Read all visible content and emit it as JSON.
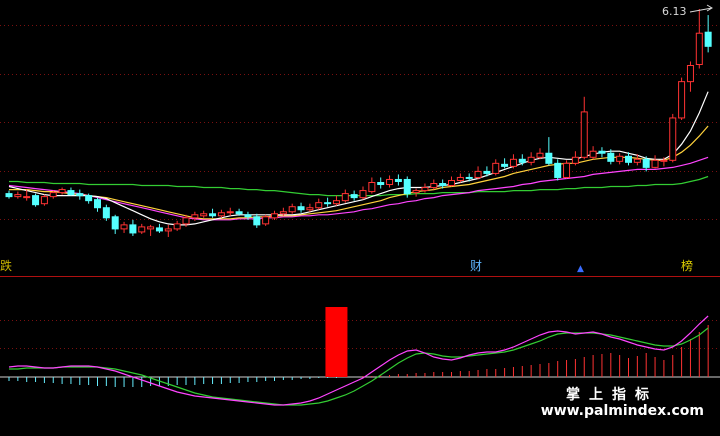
{
  "markers": {
    "left": "跌",
    "cai": "财",
    "triangle": "▲",
    "bang": "榜"
  },
  "price_max": "6.13",
  "watermark": {
    "line1": "掌上指标",
    "line2": "www.palmindex.com"
  },
  "colors": {
    "up": "#ff3333",
    "down": "#55ffff",
    "ma_white": "#ffffff",
    "ma_yellow": "#ffd23c",
    "ma_magenta": "#ff44ff",
    "ma_green": "#33cc33",
    "grid": "#7a1010",
    "macd_pos": "#ff3333",
    "macd_neg": "#66eeff",
    "signal": "#ff0000"
  },
  "chart_data": [
    {
      "type": "candlestick",
      "title": "",
      "y_annotation": "6.13",
      "candles": [
        [
          13.6,
          13.3,
          13.9,
          13.1
        ],
        [
          13.3,
          13.5,
          13.8,
          13.1
        ],
        [
          13.2,
          13.3,
          14.0,
          12.9
        ],
        [
          13.4,
          12.5,
          13.6,
          12.3
        ],
        [
          12.6,
          13.3,
          13.5,
          12.4
        ],
        [
          13.3,
          13.7,
          13.9,
          13.1
        ],
        [
          13.7,
          14.0,
          14.2,
          13.5
        ],
        [
          13.9,
          13.5,
          14.2,
          13.4
        ],
        [
          13.6,
          13.4,
          14.0,
          13.0
        ],
        [
          13.4,
          12.9,
          13.6,
          12.6
        ],
        [
          13.0,
          12.2,
          13.2,
          11.8
        ],
        [
          12.2,
          11.2,
          12.5,
          10.9
        ],
        [
          11.3,
          10.1,
          11.5,
          9.6
        ],
        [
          10.1,
          10.5,
          10.8,
          9.7
        ],
        [
          10.5,
          9.7,
          11.0,
          9.4
        ],
        [
          9.8,
          10.3,
          10.6,
          9.6
        ],
        [
          10.1,
          10.3,
          10.5,
          9.4
        ],
        [
          10.2,
          9.9,
          10.6,
          9.7
        ],
        [
          9.9,
          10.1,
          10.5,
          9.3
        ],
        [
          10.1,
          10.6,
          10.9,
          9.9
        ],
        [
          10.6,
          11.2,
          11.5,
          10.3
        ],
        [
          11.2,
          11.5,
          11.8,
          10.9
        ],
        [
          11.4,
          11.6,
          11.9,
          11.2
        ],
        [
          11.6,
          11.4,
          12.1,
          11.2
        ],
        [
          11.4,
          11.7,
          12.0,
          11.2
        ],
        [
          11.7,
          11.8,
          12.2,
          11.4
        ],
        [
          11.8,
          11.6,
          12.1,
          11.4
        ],
        [
          11.5,
          11.3,
          11.8,
          11.0
        ],
        [
          11.3,
          10.5,
          11.6,
          10.2
        ],
        [
          10.6,
          11.3,
          11.5,
          10.4
        ],
        [
          11.2,
          11.6,
          11.9,
          11.0
        ],
        [
          11.6,
          11.8,
          12.2,
          11.4
        ],
        [
          11.8,
          12.3,
          12.6,
          11.6
        ],
        [
          12.3,
          12.0,
          12.7,
          11.7
        ],
        [
          12.0,
          12.2,
          12.6,
          11.8
        ],
        [
          12.2,
          12.7,
          13.1,
          12.0
        ],
        [
          12.7,
          12.6,
          13.2,
          12.3
        ],
        [
          12.6,
          12.9,
          13.4,
          12.4
        ],
        [
          12.9,
          13.6,
          14.0,
          12.7
        ],
        [
          13.5,
          13.2,
          13.9,
          12.9
        ],
        [
          13.2,
          13.9,
          14.3,
          13.0
        ],
        [
          13.8,
          14.7,
          15.2,
          13.6
        ],
        [
          14.7,
          14.5,
          15.2,
          14.1
        ],
        [
          14.5,
          15.0,
          15.4,
          14.2
        ],
        [
          15.0,
          14.8,
          15.5,
          14.4
        ],
        [
          15.0,
          13.6,
          15.3,
          13.2
        ],
        [
          13.7,
          13.9,
          14.1,
          13.3
        ],
        [
          13.9,
          14.2,
          14.6,
          13.7
        ],
        [
          14.2,
          14.6,
          15.0,
          14.0
        ],
        [
          14.6,
          14.4,
          15.0,
          14.1
        ],
        [
          14.4,
          14.9,
          15.3,
          14.3
        ],
        [
          14.9,
          15.2,
          15.6,
          14.7
        ],
        [
          15.2,
          15.1,
          15.6,
          14.8
        ],
        [
          15.2,
          15.8,
          16.3,
          15.0
        ],
        [
          15.8,
          15.6,
          16.3,
          15.3
        ],
        [
          15.6,
          16.6,
          17.0,
          15.4
        ],
        [
          16.5,
          16.3,
          17.1,
          16.1
        ],
        [
          16.3,
          17.0,
          17.5,
          16.1
        ],
        [
          17.0,
          16.7,
          17.5,
          16.4
        ],
        [
          16.7,
          17.2,
          17.7,
          16.4
        ],
        [
          17.2,
          17.6,
          18.1,
          17.0
        ],
        [
          17.6,
          16.6,
          19.2,
          16.4
        ],
        [
          16.6,
          15.2,
          17.0,
          14.9
        ],
        [
          15.2,
          16.6,
          16.9,
          15.1
        ],
        [
          16.6,
          17.2,
          17.8,
          16.4
        ],
        [
          17.2,
          21.7,
          23.2,
          17.0
        ],
        [
          17.2,
          17.8,
          18.3,
          17.0
        ],
        [
          17.8,
          17.6,
          18.2,
          17.2
        ],
        [
          17.6,
          16.8,
          18.0,
          16.5
        ],
        [
          16.8,
          17.3,
          17.6,
          16.5
        ],
        [
          17.3,
          16.7,
          17.7,
          16.4
        ],
        [
          16.7,
          17.0,
          17.5,
          16.4
        ],
        [
          17.0,
          16.2,
          17.3,
          15.8
        ],
        [
          16.2,
          16.9,
          17.4,
          16.1
        ],
        [
          16.8,
          16.9,
          17.2,
          16.3
        ],
        [
          16.9,
          21.1,
          21.5,
          16.7
        ],
        [
          21.1,
          24.7,
          25.1,
          20.9
        ],
        [
          24.7,
          26.3,
          26.7,
          23.7
        ],
        [
          26.4,
          29.5,
          31.9,
          26.0
        ],
        [
          29.6,
          28.2,
          31.3,
          27.6
        ]
      ],
      "ma_white": [
        14.3,
        14.1,
        13.9,
        13.7,
        13.5,
        13.4,
        13.4,
        13.4,
        13.4,
        13.4,
        13.3,
        13.1,
        12.7,
        12.3,
        11.9,
        11.5,
        11.1,
        10.8,
        10.6,
        10.5,
        10.5,
        10.6,
        10.8,
        11.0,
        11.2,
        11.4,
        11.5,
        11.5,
        11.5,
        11.5,
        11.5,
        11.5,
        11.5,
        11.6,
        11.8,
        12.0,
        12.2,
        12.4,
        12.6,
        12.8,
        13.0,
        13.3,
        13.6,
        13.9,
        14.1,
        14.2,
        14.2,
        14.2,
        14.3,
        14.4,
        14.5,
        14.7,
        14.9,
        15.1,
        15.4,
        15.7,
        16.0,
        16.3,
        16.6,
        16.9,
        17.1,
        17.2,
        17.1,
        17.0,
        17.0,
        17.3,
        17.5,
        17.7,
        17.8,
        17.8,
        17.6,
        17.4,
        17.1,
        17.0,
        17.0,
        17.5,
        18.5,
        19.8,
        21.6,
        23.7
      ],
      "ma_yellow": [
        14.0,
        14.0,
        14.0,
        13.9,
        13.8,
        13.8,
        13.7,
        13.6,
        13.5,
        13.4,
        13.3,
        13.2,
        13.0,
        12.8,
        12.6,
        12.4,
        12.2,
        12.0,
        11.8,
        11.6,
        11.4,
        11.2,
        11.1,
        11.1,
        11.1,
        11.1,
        11.2,
        11.2,
        11.3,
        11.3,
        11.4,
        11.4,
        11.4,
        11.5,
        11.6,
        11.7,
        11.8,
        11.9,
        12.1,
        12.3,
        12.5,
        12.7,
        12.9,
        13.2,
        13.4,
        13.6,
        13.8,
        13.9,
        14.0,
        14.2,
        14.3,
        14.4,
        14.5,
        14.7,
        14.9,
        15.1,
        15.3,
        15.6,
        15.8,
        16.0,
        16.2,
        16.4,
        16.5,
        16.6,
        16.6,
        16.8,
        17.0,
        17.1,
        17.2,
        17.2,
        17.2,
        17.1,
        17.0,
        16.9,
        16.9,
        17.2,
        17.7,
        18.4,
        19.3,
        20.3
      ],
      "ma_magenta": [
        14.4,
        14.3,
        14.2,
        14.1,
        14.0,
        13.9,
        13.8,
        13.7,
        13.6,
        13.4,
        13.2,
        13.0,
        12.8,
        12.6,
        12.4,
        12.2,
        12.0,
        11.8,
        11.6,
        11.4,
        11.2,
        11.1,
        11.0,
        11.0,
        11.0,
        11.0,
        11.1,
        11.1,
        11.1,
        11.2,
        11.2,
        11.3,
        11.3,
        11.4,
        11.4,
        11.5,
        11.5,
        11.6,
        11.7,
        11.8,
        12.0,
        12.1,
        12.3,
        12.5,
        12.6,
        12.8,
        12.9,
        13.1,
        13.2,
        13.4,
        13.5,
        13.6,
        13.7,
        13.9,
        14.0,
        14.1,
        14.2,
        14.3,
        14.5,
        14.6,
        14.8,
        14.9,
        15.0,
        15.1,
        15.2,
        15.3,
        15.5,
        15.6,
        15.7,
        15.8,
        15.9,
        16.0,
        16.0,
        16.0,
        16.1,
        16.2,
        16.4,
        16.6,
        16.9,
        17.2
      ],
      "ma_green": [
        14.8,
        14.8,
        14.7,
        14.7,
        14.7,
        14.6,
        14.6,
        14.6,
        14.6,
        14.5,
        14.5,
        14.5,
        14.5,
        14.5,
        14.5,
        14.4,
        14.4,
        14.4,
        14.4,
        14.3,
        14.3,
        14.3,
        14.2,
        14.2,
        14.2,
        14.1,
        14.1,
        14.0,
        14.0,
        13.9,
        13.9,
        13.8,
        13.7,
        13.6,
        13.5,
        13.5,
        13.4,
        13.4,
        13.4,
        13.4,
        13.4,
        13.4,
        13.4,
        13.5,
        13.5,
        13.5,
        13.6,
        13.6,
        13.6,
        13.7,
        13.7,
        13.7,
        13.7,
        13.8,
        13.8,
        13.8,
        13.8,
        13.9,
        13.9,
        13.9,
        14.0,
        14.0,
        14.0,
        14.1,
        14.1,
        14.2,
        14.2,
        14.2,
        14.3,
        14.3,
        14.3,
        14.4,
        14.4,
        14.5,
        14.5,
        14.5,
        14.6,
        14.8,
        15.0,
        15.3
      ],
      "yrange": [
        9,
        32
      ]
    },
    {
      "type": "macd",
      "dif": [
        0.1,
        0.11,
        0.11,
        0.1,
        0.09,
        0.09,
        0.1,
        0.11,
        0.11,
        0.11,
        0.1,
        0.08,
        0.06,
        0.03,
        0.0,
        -0.03,
        -0.06,
        -0.09,
        -0.12,
        -0.15,
        -0.17,
        -0.19,
        -0.2,
        -0.21,
        -0.22,
        -0.23,
        -0.24,
        -0.25,
        -0.26,
        -0.27,
        -0.28,
        -0.28,
        -0.27,
        -0.26,
        -0.24,
        -0.21,
        -0.17,
        -0.13,
        -0.09,
        -0.05,
        -0.01,
        0.05,
        0.11,
        0.17,
        0.22,
        0.26,
        0.27,
        0.24,
        0.2,
        0.18,
        0.17,
        0.19,
        0.22,
        0.24,
        0.25,
        0.25,
        0.27,
        0.3,
        0.34,
        0.38,
        0.42,
        0.45,
        0.46,
        0.45,
        0.43,
        0.44,
        0.45,
        0.43,
        0.4,
        0.38,
        0.35,
        0.32,
        0.3,
        0.28,
        0.27,
        0.3,
        0.36,
        0.44,
        0.53,
        0.61
      ],
      "dea": [
        0.08,
        0.08,
        0.09,
        0.09,
        0.09,
        0.09,
        0.1,
        0.1,
        0.1,
        0.1,
        0.1,
        0.09,
        0.08,
        0.06,
        0.04,
        0.02,
        -0.01,
        -0.04,
        -0.07,
        -0.1,
        -0.13,
        -0.16,
        -0.18,
        -0.2,
        -0.21,
        -0.22,
        -0.23,
        -0.24,
        -0.25,
        -0.26,
        -0.27,
        -0.28,
        -0.28,
        -0.28,
        -0.27,
        -0.26,
        -0.24,
        -0.21,
        -0.18,
        -0.14,
        -0.09,
        -0.04,
        0.02,
        0.08,
        0.14,
        0.19,
        0.23,
        0.24,
        0.23,
        0.21,
        0.2,
        0.2,
        0.21,
        0.22,
        0.23,
        0.24,
        0.25,
        0.27,
        0.3,
        0.33,
        0.36,
        0.4,
        0.43,
        0.44,
        0.44,
        0.44,
        0.44,
        0.43,
        0.42,
        0.4,
        0.38,
        0.36,
        0.34,
        0.32,
        0.31,
        0.31,
        0.33,
        0.37,
        0.42,
        0.49
      ],
      "hist": [
        -0.04,
        -0.04,
        -0.05,
        -0.05,
        -0.06,
        -0.06,
        -0.07,
        -0.07,
        -0.08,
        -0.08,
        -0.09,
        -0.09,
        -0.1,
        -0.1,
        -0.1,
        -0.1,
        -0.09,
        -0.09,
        -0.09,
        -0.08,
        -0.08,
        -0.08,
        -0.07,
        -0.07,
        -0.07,
        -0.06,
        -0.06,
        -0.05,
        -0.05,
        -0.04,
        -0.04,
        -0.03,
        -0.03,
        -0.02,
        -0.02,
        -0.01,
        -0.01,
        -0.01,
        0.0,
        0.0,
        0.01,
        0.01,
        0.02,
        0.02,
        0.03,
        0.03,
        0.04,
        0.04,
        0.05,
        0.05,
        0.05,
        0.06,
        0.06,
        0.07,
        0.08,
        0.08,
        0.09,
        0.1,
        0.11,
        0.12,
        0.13,
        0.14,
        0.16,
        0.17,
        0.18,
        0.2,
        0.22,
        0.23,
        0.24,
        0.22,
        0.19,
        0.21,
        0.24,
        0.2,
        0.17,
        0.22,
        0.3,
        0.38,
        0.45,
        0.52
      ],
      "signal_bar": {
        "index": 37,
        "value": 0.7
      },
      "yrange": [
        -0.55,
        0.72
      ]
    }
  ]
}
